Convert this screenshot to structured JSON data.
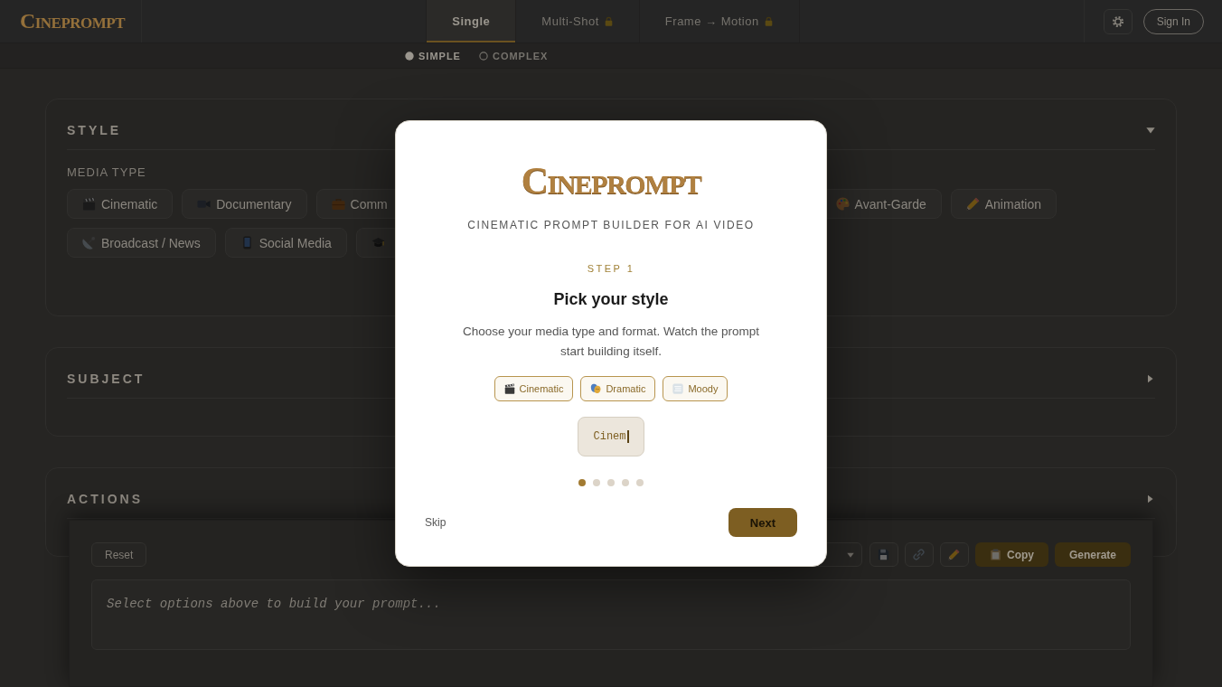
{
  "header": {
    "logo": "CINEPROMPT",
    "tabs": [
      {
        "label": "Single",
        "selected": true,
        "locked": false
      },
      {
        "label": "Multi-Shot",
        "selected": false,
        "locked": true
      },
      {
        "label": "Frame → Motion",
        "selected": false,
        "locked": true
      }
    ],
    "sign_in": "Sign In"
  },
  "modes": [
    {
      "label": "SIMPLE",
      "selected": true
    },
    {
      "label": "COMPLEX",
      "selected": false
    }
  ],
  "sections": [
    {
      "title": "STYLE",
      "expanded": true,
      "field": {
        "label": "MEDIA TYPE",
        "rows": [
          [
            {
              "label": "Cinematic"
            },
            {
              "label": "Documentary"
            },
            {
              "label": "Comm"
            },
            {
              "label": "Avant-Garde"
            },
            {
              "label": "Animation"
            }
          ],
          [
            {
              "label": "Broadcast / News"
            },
            {
              "label": "Social Media"
            },
            {}
          ]
        ]
      }
    },
    {
      "title": "SUBJECT",
      "expanded": false
    },
    {
      "title": "ACTIONS",
      "expanded": false
    }
  ],
  "prompt_panel": {
    "reset": "Reset",
    "copy": "Copy",
    "generate": "Generate",
    "placeholder": "Select options above to build your prompt..."
  },
  "onboarding": {
    "logo": "CINEPROMPT",
    "tagline": "CINEMATIC PROMPT BUILDER FOR AI VIDEO",
    "step": "STEP 1",
    "title": "Pick your style",
    "text": "Choose your media type and format. Watch the prompt start building itself.",
    "chips": [
      "Cinematic",
      "Dramatic",
      "Moody"
    ],
    "preview": "Cinem",
    "steps": [
      {
        "selected": true
      },
      {
        "selected": false
      },
      {
        "selected": false
      },
      {
        "selected": false
      },
      {
        "selected": false
      }
    ],
    "skip": "Skip",
    "next": "Next"
  }
}
